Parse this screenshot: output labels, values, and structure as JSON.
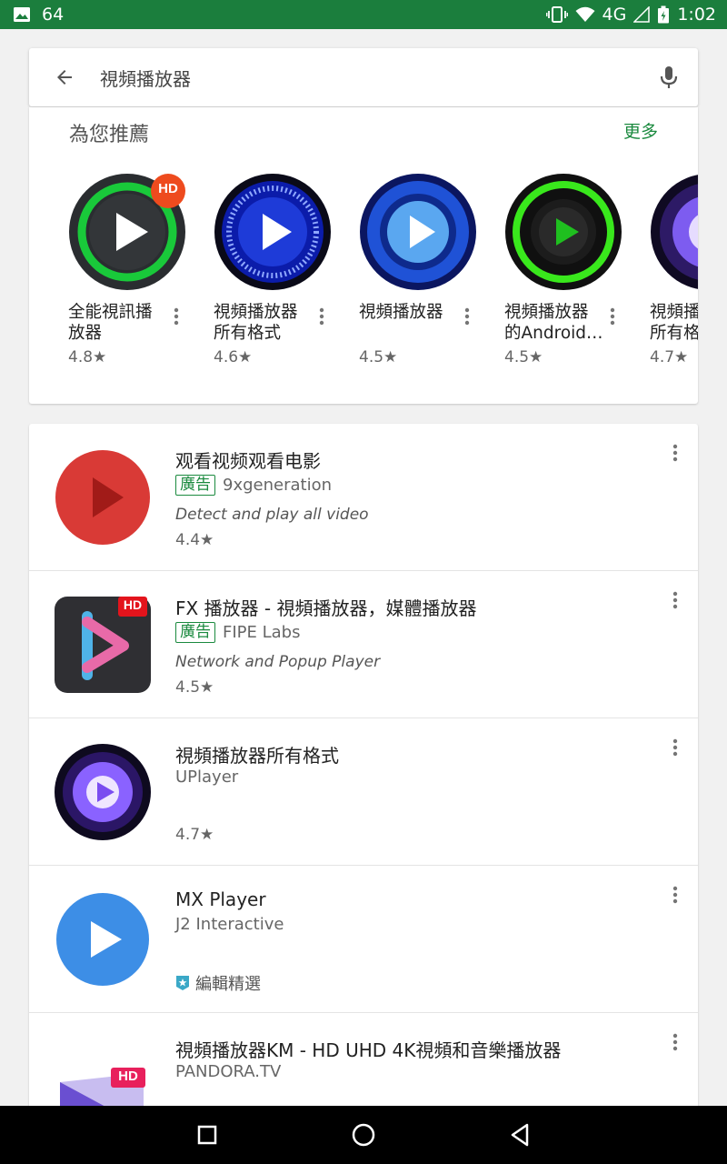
{
  "status_bar": {
    "notification_count": "64",
    "network": "4G",
    "time": "1:02"
  },
  "search": {
    "query": "視頻播放器",
    "back_icon": "arrow-back-icon",
    "mic_icon": "mic-icon"
  },
  "recommended": {
    "title": "為您推薦",
    "more": "更多",
    "items": [
      {
        "name": "全能視訊播放器",
        "rating": "4.8★",
        "badge": "HD"
      },
      {
        "name": "視頻播放器所有格式",
        "rating": "4.6★"
      },
      {
        "name": "視頻播放器",
        "rating": "4.5★"
      },
      {
        "name": "視頻播放器的Android…",
        "rating": "4.5★"
      },
      {
        "name": "視頻播放器所有格式",
        "rating": "4.7★"
      }
    ]
  },
  "apps": [
    {
      "title": "观看视频观看电影",
      "ad": "廣告",
      "developer": "9xgeneration",
      "description": "Detect and play all video",
      "rating": "4.4★"
    },
    {
      "title": "FX 播放器 - 視頻播放器，媒體播放器",
      "ad": "廣告",
      "developer": "FIPE Labs",
      "description": "Network and Popup Player",
      "rating": "4.5★",
      "badge": "HD"
    },
    {
      "title": "視頻播放器所有格式",
      "developer": "UPlayer",
      "rating": "4.7★"
    },
    {
      "title": "MX Player",
      "developer": "J2 Interactive",
      "editors_choice": "編輯精選"
    },
    {
      "title": "視頻播放器KM - HD UHD 4K視頻和音樂播放器",
      "developer": "PANDORA.TV",
      "badge": "HD"
    }
  ],
  "colors": {
    "status_bar": "#1b7e3d",
    "accent": "#1b8a3f",
    "background": "#f1f1f1"
  }
}
